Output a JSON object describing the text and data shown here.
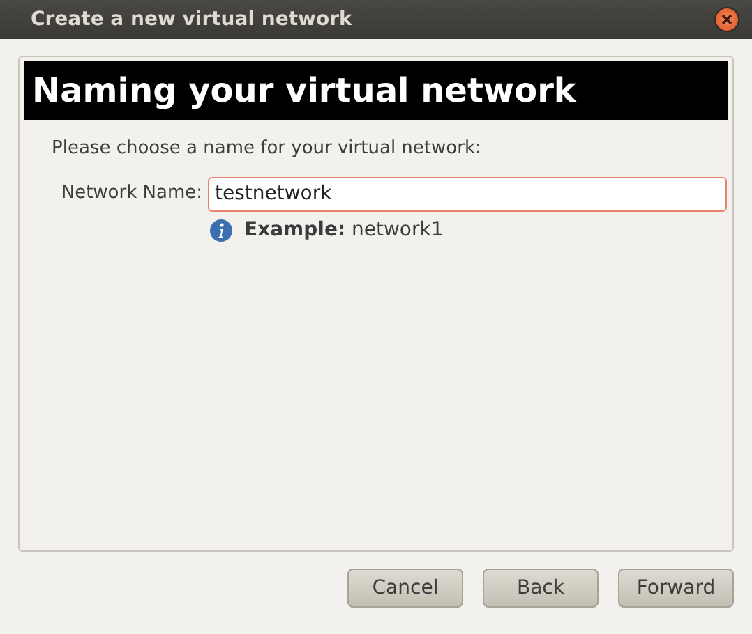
{
  "window": {
    "title": "Create a new virtual network"
  },
  "header": "Naming your virtual network",
  "prompt": "Please choose a name for your virtual network:",
  "field": {
    "label": "Network Name:",
    "value": "testnetwork"
  },
  "hint": "**Example:** network1",
  "buttons": [
    "Cancel",
    "Back",
    "Forward"
  ]
}
